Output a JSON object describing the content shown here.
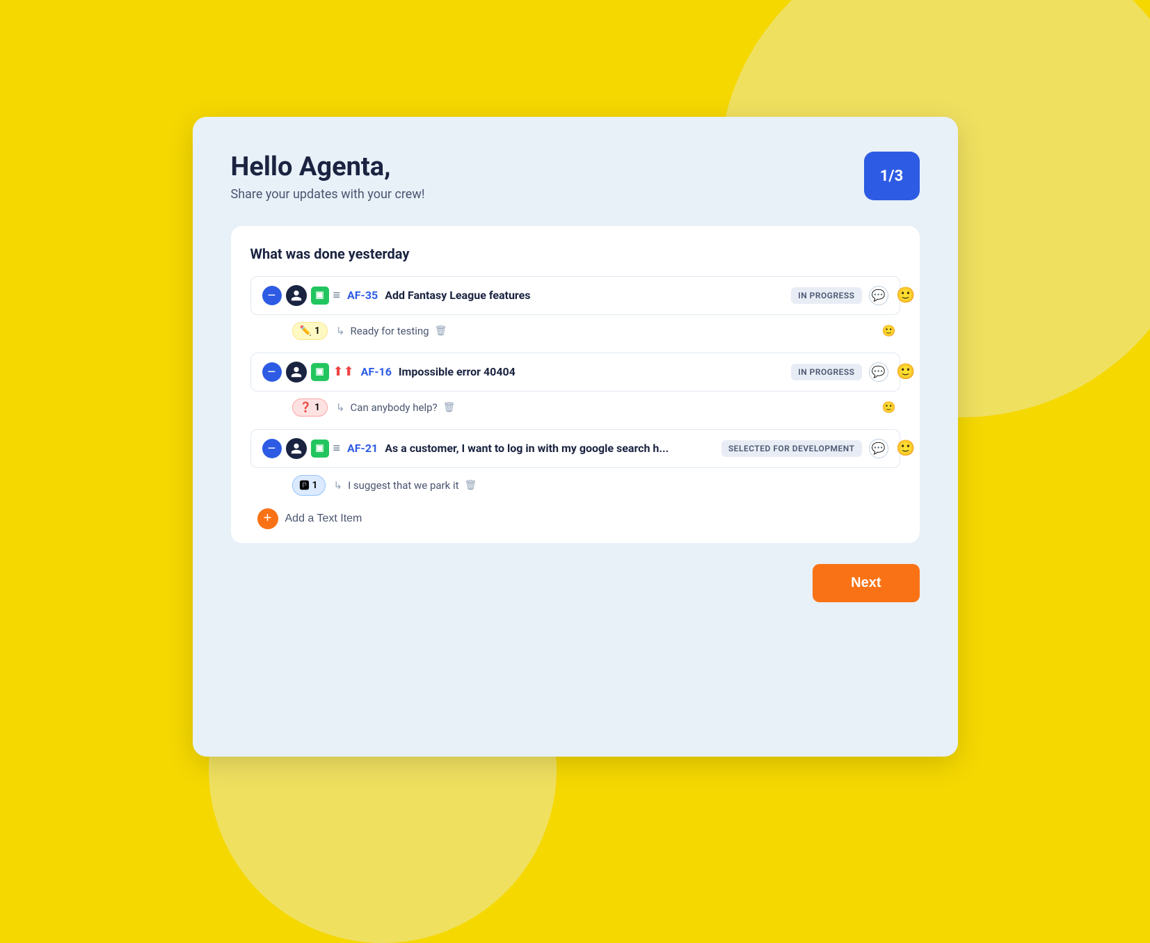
{
  "background": {
    "color": "#f5d800"
  },
  "modal": {
    "greeting_title": "Hello Agenta,",
    "greeting_subtitle": "Share your updates with your crew!",
    "page_badge": "1/3",
    "section_title": "What was done yesterday",
    "tasks": [
      {
        "id": "task-1",
        "task_id": "AF-35",
        "task_title": "Add Fantasy League features",
        "status": "IN PROGRESS",
        "note_emoji": "✏️",
        "note_count": "1",
        "note_text": "Ready for testing",
        "type": "story"
      },
      {
        "id": "task-2",
        "task_id": "AF-16",
        "task_title": "Impossible error 40404",
        "status": "IN PROGRESS",
        "note_emoji": "❓",
        "note_count": "1",
        "note_text": "Can anybody help?",
        "type": "bug",
        "priority": "high"
      },
      {
        "id": "task-3",
        "task_id": "AF-21",
        "task_title": "As a customer, I want to log in with my google search h...",
        "status": "SELECTED FOR DEVELOPMENT",
        "note_emoji": "🅿️",
        "note_count": "1",
        "note_text": "I suggest that we park it",
        "type": "story"
      }
    ],
    "add_text_label": "Add a Text Item",
    "next_button_label": "Next"
  }
}
